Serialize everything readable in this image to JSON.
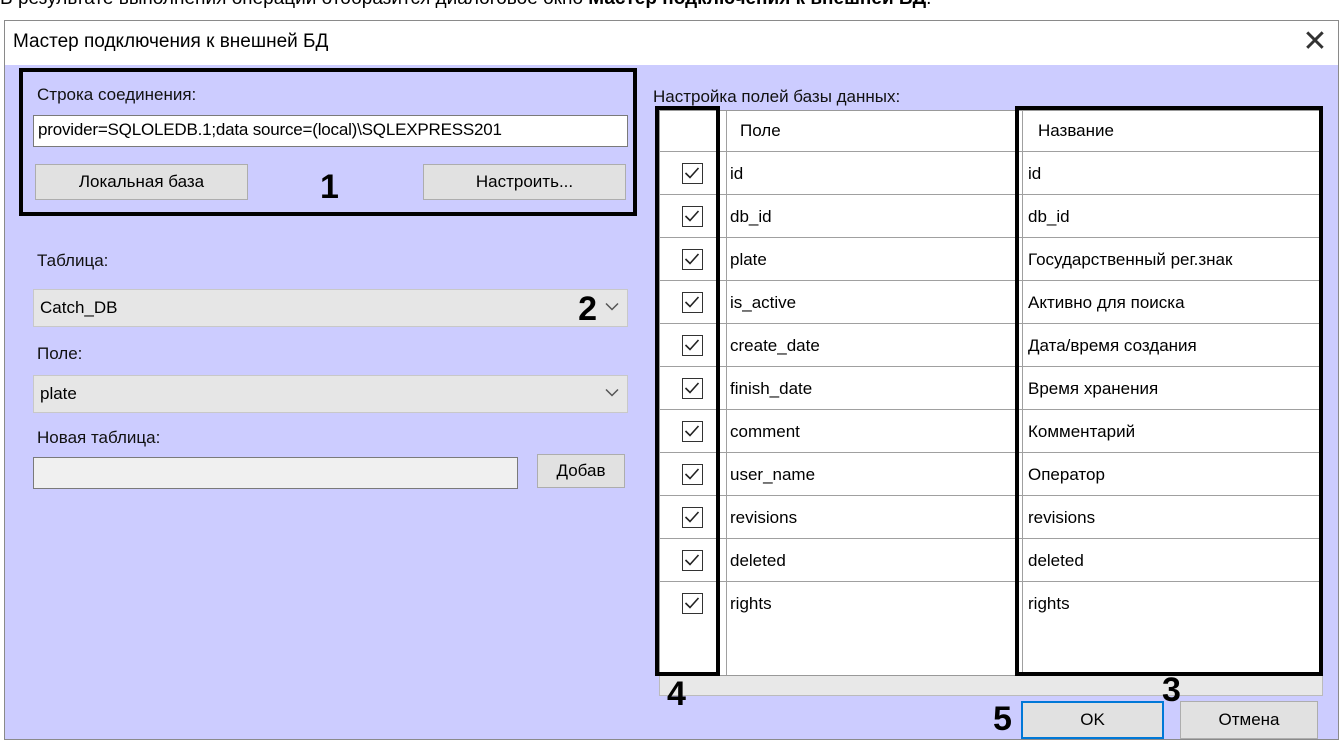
{
  "doc": {
    "prefix": "В результате выполнения операции отобразится диалоговое окно ",
    "bold": "Мастер подключения к внешней БД",
    "suffix": "."
  },
  "window": {
    "title": "Мастер подключения к внешней БД",
    "close_glyph": "✕"
  },
  "connection": {
    "label": "Строка соединения:",
    "value": "provider=SQLOLEDB.1;data source=(local)\\SQLEXPRESS201",
    "local_db_button": "Локальная база",
    "configure_button": "Настроить..."
  },
  "table": {
    "label": "Таблица:",
    "selected": "Catch_DB"
  },
  "field": {
    "label": "Поле:",
    "selected": "plate"
  },
  "new_table": {
    "label": "Новая таблица:",
    "value": "",
    "add_button": "Добав"
  },
  "db_fields": {
    "label": "Настройка полей базы данных:",
    "columns": {
      "field": "Поле",
      "name": "Название"
    },
    "rows": [
      {
        "checked": true,
        "field": "id",
        "name": "id"
      },
      {
        "checked": true,
        "field": "db_id",
        "name": "db_id"
      },
      {
        "checked": true,
        "field": "plate",
        "name": "Государственный рег.знак"
      },
      {
        "checked": true,
        "field": "is_active",
        "name": "Активно для поиска"
      },
      {
        "checked": true,
        "field": "create_date",
        "name": "Дата/время создания"
      },
      {
        "checked": true,
        "field": "finish_date",
        "name": "Время хранения"
      },
      {
        "checked": true,
        "field": "comment",
        "name": "Комментарий"
      },
      {
        "checked": true,
        "field": "user_name",
        "name": "Оператор"
      },
      {
        "checked": true,
        "field": "revisions",
        "name": "revisions"
      },
      {
        "checked": true,
        "field": "deleted",
        "name": "deleted"
      },
      {
        "checked": true,
        "field": "rights",
        "name": "rights"
      }
    ]
  },
  "buttons": {
    "ok": "OK",
    "cancel": "Отмена"
  },
  "annotations": {
    "m1": "1",
    "m2": "2",
    "m3": "3",
    "m4": "4",
    "m5": "5"
  },
  "colors": {
    "dialog_bg": "#ccccff",
    "ok_border": "#0078d7",
    "callout": "#000000"
  },
  "icons": {
    "close": "close-icon",
    "dropdown": "chevron-down-icon",
    "checkbox": "checkmark-icon"
  }
}
